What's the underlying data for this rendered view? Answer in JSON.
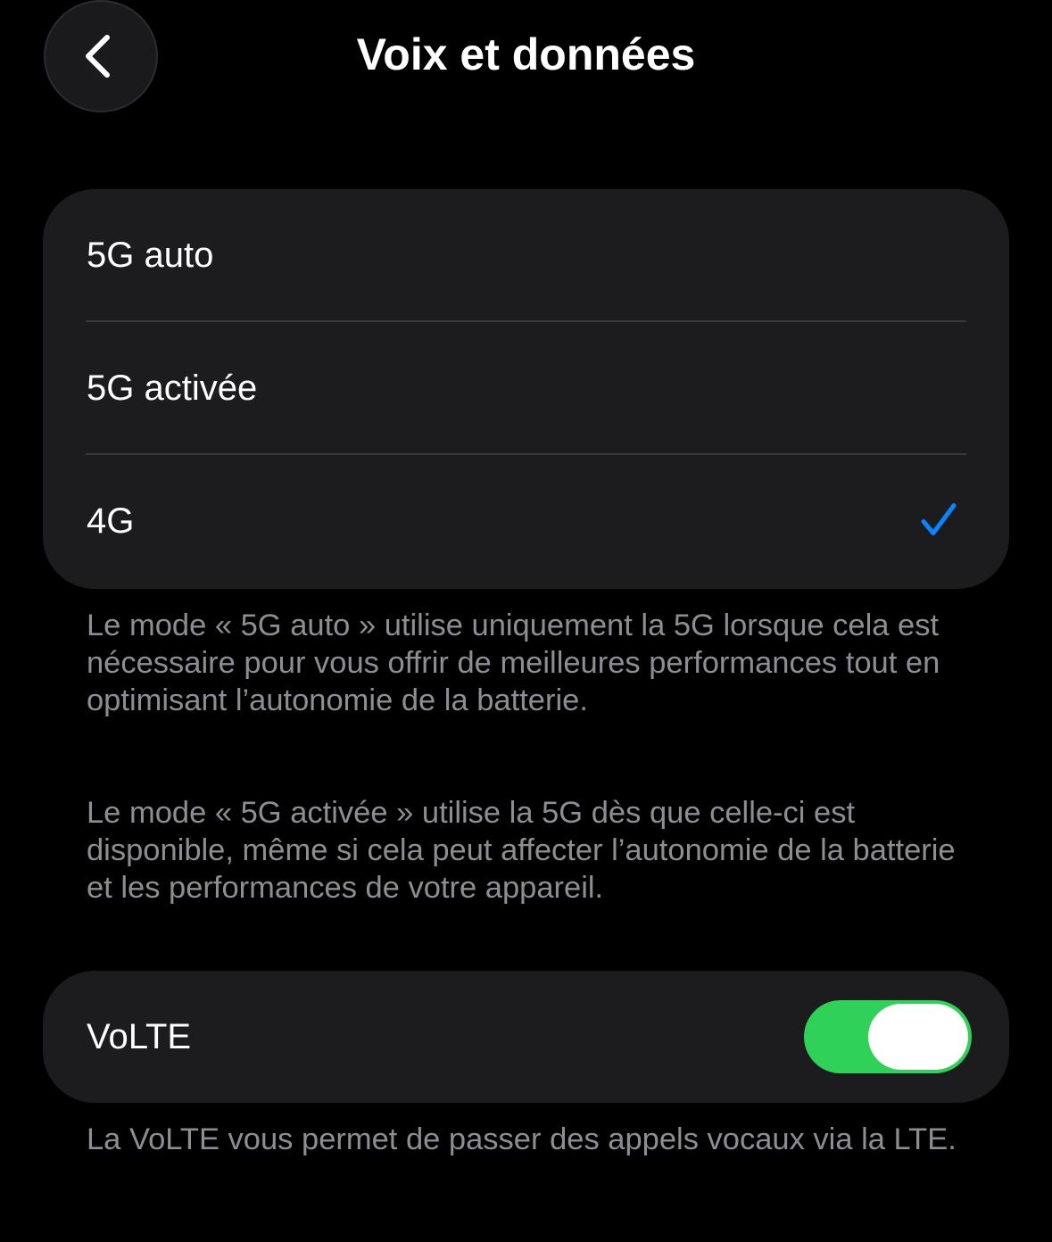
{
  "header": {
    "title": "Voix et données",
    "back_icon": "chevron-left-icon"
  },
  "network_options": {
    "items": [
      {
        "label": "5G auto",
        "selected": false
      },
      {
        "label": "5G activée",
        "selected": false
      },
      {
        "label": "4G",
        "selected": true
      }
    ],
    "checkmark_icon": "checkmark-icon",
    "accent_color": "#0a84ff"
  },
  "explanations": {
    "auto_text": "Le mode « 5G auto » utilise uniquement la 5G lorsque cela est nécessaire pour vous offrir de meilleures performances tout en optimisant l’autonomie de la batterie.",
    "on_text": "Le mode « 5G activée » utilise la 5G dès que celle-ci est disponible, même si cela peut affecter l’autonomie de la batterie et les performances de votre appareil."
  },
  "volte": {
    "label": "VoLTE",
    "enabled": true,
    "toggle_color": "#30d158",
    "description": "La VoLTE vous permet de passer des appels vocaux via la LTE."
  }
}
